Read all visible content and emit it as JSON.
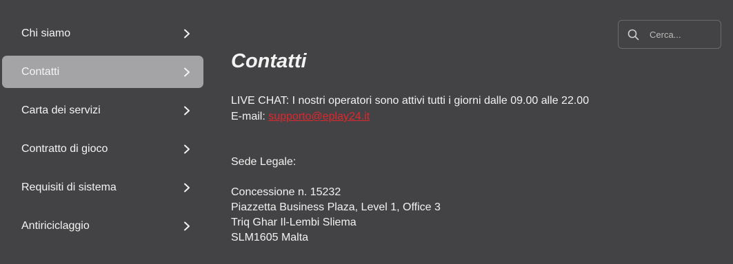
{
  "sidebar": {
    "items": [
      {
        "label": "Chi siamo",
        "active": false
      },
      {
        "label": "Contatti",
        "active": true
      },
      {
        "label": "Carta dei servizi",
        "active": false
      },
      {
        "label": "Contratto di gioco",
        "active": false
      },
      {
        "label": "Requisiti di sistema",
        "active": false
      },
      {
        "label": "Antiriciclaggio",
        "active": false
      }
    ]
  },
  "search": {
    "placeholder": "Cerca..."
  },
  "main": {
    "title": "Contatti",
    "live_chat": "LIVE CHAT: I nostri operatori sono attivi tutti i giorni dalle 09.00 alle 22.00",
    "email_label": "E-mail:",
    "email_value": "supporto@eplay24.it",
    "sede_heading": "Sede Legale:",
    "address": [
      "Concessione n. 15232",
      "Piazzetta Business Plaza, Level 1, Office 3",
      "Triq Ghar Il-Lembi Sliema",
      "SLM1605 Malta"
    ]
  },
  "colors": {
    "background": "#434345",
    "active_item": "#a4a4a6",
    "link": "#e0262e",
    "text": "#f2f2f2"
  },
  "icons": {
    "chevron": "chevron-right-icon",
    "search": "search-icon"
  }
}
